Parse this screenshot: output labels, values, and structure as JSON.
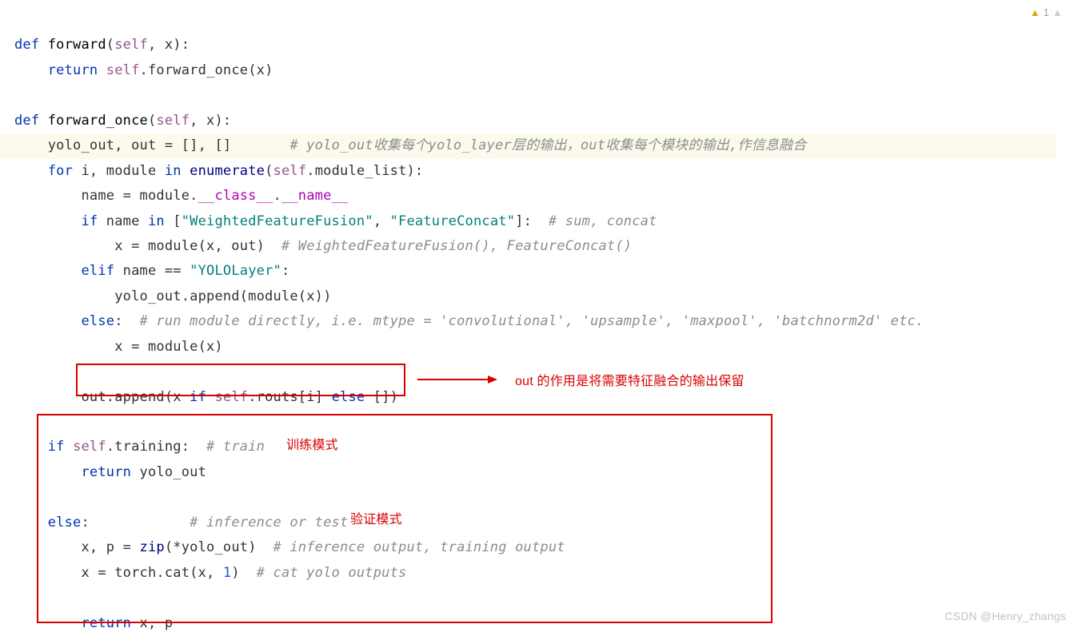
{
  "warning": {
    "count": "1"
  },
  "code": {
    "l1_def": "def",
    "l1_fn": "forward",
    "l1_self": "self",
    "l1_x": ", x):",
    "l2_ret": "return",
    "l2_self": "self",
    "l2_call": ".forward_once(x)",
    "l4_def": "def",
    "l4_fn": "forward_once",
    "l4_self": "self",
    "l4_x": ", x):",
    "l5_lhs": "yolo_out, out = [], []",
    "l5_cmt": "# yolo_out收集每个yolo_layer层的输出，out收集每个模块的输出,作信息融合",
    "l6_for": "for",
    "l6_mid": " i, module ",
    "l6_in": "in",
    "l6_enum": "enumerate",
    "l6_self": "self",
    "l6_tail": ".module_list):",
    "l7_a": "name = module.",
    "l7_cls": "__class__",
    "l7_dot": ".",
    "l7_name": "__name__",
    "l8_if": "if",
    "l8_a": " name ",
    "l8_in": "in",
    "l8_b": " [",
    "l8_s1": "\"WeightedFeatureFusion\"",
    "l8_c": ", ",
    "l8_s2": "\"FeatureConcat\"",
    "l8_d": "]:  ",
    "l8_cmt": "# sum, concat",
    "l9_a": "x = module(x, out)  ",
    "l9_cmt": "# WeightedFeatureFusion(), FeatureConcat()",
    "l10_elif": "elif",
    "l10_a": " name == ",
    "l10_s": "\"YOLOLayer\"",
    "l10_b": ":",
    "l11": "yolo_out.append(module(x))",
    "l12_else": "else",
    "l12_a": ":  ",
    "l12_cmt": "# run module directly, i.e. mtype = 'convolutional', 'upsample', 'maxpool', 'batchnorm2d' etc.",
    "l13": "x = module(x)",
    "l15_a": "out.append(x ",
    "l15_if": "if",
    "l15_self": "self",
    "l15_b": ".routs[i] ",
    "l15_else": "else",
    "l15_c": " [])",
    "l17_if": "if",
    "l17_self": "self",
    "l17_a": ".training:  ",
    "l17_cmt": "# train",
    "l18_ret": "return",
    "l18_a": " yolo_out",
    "l20_else": "else",
    "l20_a": ":            ",
    "l20_cmt": "# inference or test",
    "l21_a": "x, p = ",
    "l21_zip": "zip",
    "l21_b": "(*yolo_out)  ",
    "l21_cmt": "# inference output, training output",
    "l22_a": "x = torch.cat(x, ",
    "l22_n": "1",
    "l22_b": ")  ",
    "l22_cmt": "# cat yolo outputs",
    "l24_ret": "return",
    "l24_a": " x, p"
  },
  "anno": {
    "a1": "out 的作用是将需要特征融合的输出保留",
    "a2": "训练模式",
    "a3": "验证模式"
  },
  "watermark": "CSDN @Henry_zhangs"
}
